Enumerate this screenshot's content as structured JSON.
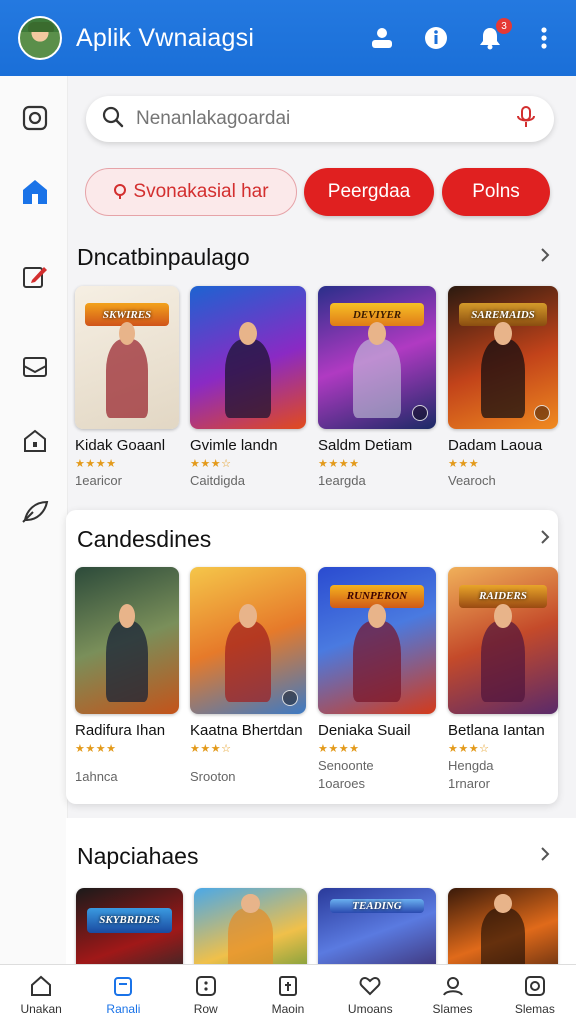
{
  "header": {
    "title": "Aplik Vwnaiagsi",
    "notification_count": "3"
  },
  "search": {
    "placeholder": "Nenanlakagoardai"
  },
  "chips": [
    {
      "label": "Svonakasial har",
      "style": "outline"
    },
    {
      "label": "Peergdaa",
      "style": "filled"
    },
    {
      "label": "Polns",
      "style": "filled"
    }
  ],
  "sections": [
    {
      "title": "Dncatbinpaulago",
      "games": [
        {
          "title": "Kidak Goaanl",
          "stars": 4,
          "meta": "1earicor",
          "banner": "SKWIRES"
        },
        {
          "title": "Gvimle landn",
          "stars": 3.5,
          "meta": "Caitdigda",
          "banner": ""
        },
        {
          "title": "Saldm Detiam",
          "stars": 4,
          "meta": "1eargda",
          "banner": "DEVIYER"
        },
        {
          "title": "Dadam Laoua",
          "stars": 3,
          "meta": "Vearoch",
          "banner": "SAREMAIDS"
        }
      ]
    },
    {
      "title": "Candesdines",
      "games": [
        {
          "title": "Radifura Ihan",
          "stars": 4,
          "meta": "1ahnca",
          "meta2": "",
          "banner": ""
        },
        {
          "title": "Kaatna Bhertdan",
          "stars": 3.5,
          "meta": "Srooton",
          "meta2": "",
          "banner": ""
        },
        {
          "title": "Deniaka Suail",
          "stars": 4,
          "meta": "1oaroes",
          "meta2": "Senoonte",
          "banner": "RUNPERON"
        },
        {
          "title": "Betlana Iantan",
          "stars": 3.5,
          "meta": "1rnaror",
          "meta2": "Hengda",
          "banner": "RAIDERS"
        }
      ]
    },
    {
      "title": "Napciahaes",
      "games": [
        {
          "banner": "SKYBRIDES"
        },
        {
          "banner": ""
        },
        {
          "banner": "TEADING"
        },
        {
          "banner": ""
        }
      ]
    }
  ],
  "bottom_nav": [
    {
      "label": "Unakan",
      "icon": "home-icon",
      "active": false
    },
    {
      "label": "Ranali",
      "icon": "bag-icon",
      "active": true
    },
    {
      "label": "Row",
      "icon": "dice-icon",
      "active": false
    },
    {
      "label": "Maoin",
      "icon": "doc-icon",
      "active": false
    },
    {
      "label": "Umoans",
      "icon": "heart-icon",
      "active": false
    },
    {
      "label": "Slames",
      "icon": "profile-icon",
      "active": false
    },
    {
      "label": "Slemas",
      "icon": "square-icon",
      "active": false
    }
  ],
  "colors": {
    "header": "#1a6fd8",
    "accent_red": "#e02020",
    "active_blue": "#1a73e8",
    "star": "#e39a1b"
  }
}
